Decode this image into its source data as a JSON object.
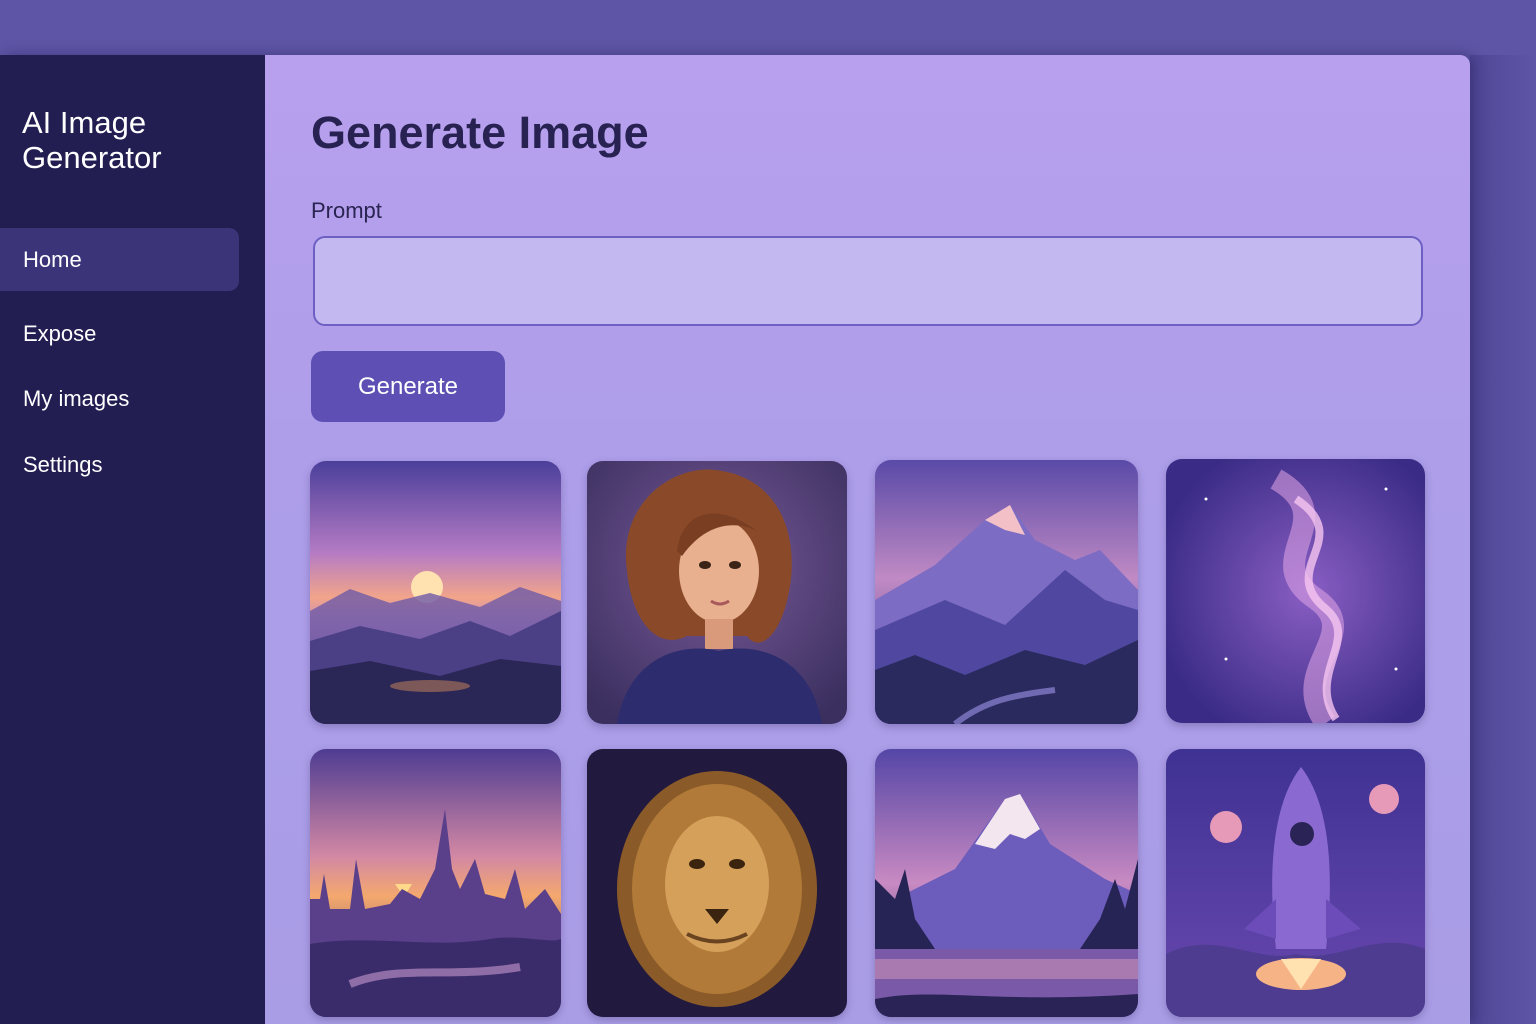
{
  "sidebar": {
    "brand": "AI Image Generator",
    "items": [
      {
        "label": "Home",
        "active": true
      },
      {
        "label": "Expose",
        "active": false
      },
      {
        "label": "My images",
        "active": false
      },
      {
        "label": "Settings",
        "active": false
      }
    ]
  },
  "main": {
    "title": "Generate Image",
    "prompt": {
      "label": "Prompt",
      "value": "",
      "placeholder": ""
    },
    "generate_label": "Generate"
  },
  "gallery": [
    {
      "subject": "sunset-valley-landscape"
    },
    {
      "subject": "woman-portrait"
    },
    {
      "subject": "mountain-range"
    },
    {
      "subject": "purple-nebula-swirl"
    },
    {
      "subject": "sunset-city-spires"
    },
    {
      "subject": "lion-portrait"
    },
    {
      "subject": "snowy-mountain-lake"
    },
    {
      "subject": "rocket-launch"
    }
  ],
  "colors": {
    "sidebar_bg": "#221e52",
    "active_item": "#3b3478",
    "main_bg": "#b3a0ec",
    "button": "#5d4fb3",
    "title": "#272252"
  }
}
